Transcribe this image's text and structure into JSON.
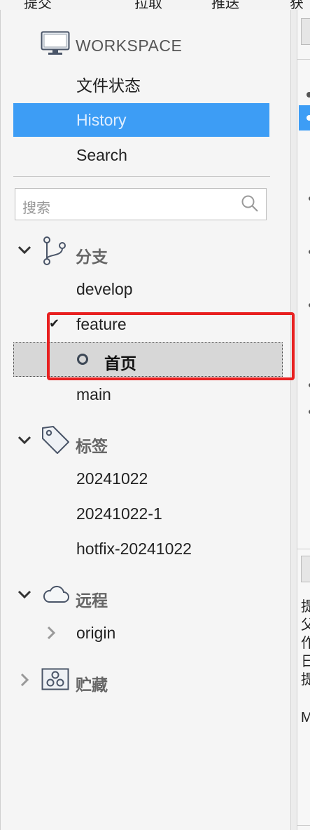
{
  "topbar": {
    "items": [
      "提交",
      "拉取",
      "推送",
      "获"
    ]
  },
  "workspace": {
    "label": "WORKSPACE",
    "items": [
      {
        "label": "文件状态",
        "selected": false
      },
      {
        "label": "History",
        "selected": true
      },
      {
        "label": "Search",
        "selected": false
      }
    ]
  },
  "search": {
    "placeholder": "搜索"
  },
  "branches": {
    "title": "分支",
    "items": [
      "develop",
      "feature",
      "main"
    ],
    "current_child": "首页"
  },
  "tags": {
    "title": "标签",
    "items": [
      "20241022",
      "20241022-1",
      "hotfix-20241022"
    ]
  },
  "remotes": {
    "title": "远程",
    "items": [
      "origin"
    ]
  },
  "stash": {
    "title": "贮藏"
  },
  "right_pane": {
    "chars": [
      "提",
      "父",
      "作",
      "日",
      "提",
      "M"
    ]
  },
  "colors": {
    "selection": "#3d9df5",
    "highlight_box": "#e82020"
  }
}
